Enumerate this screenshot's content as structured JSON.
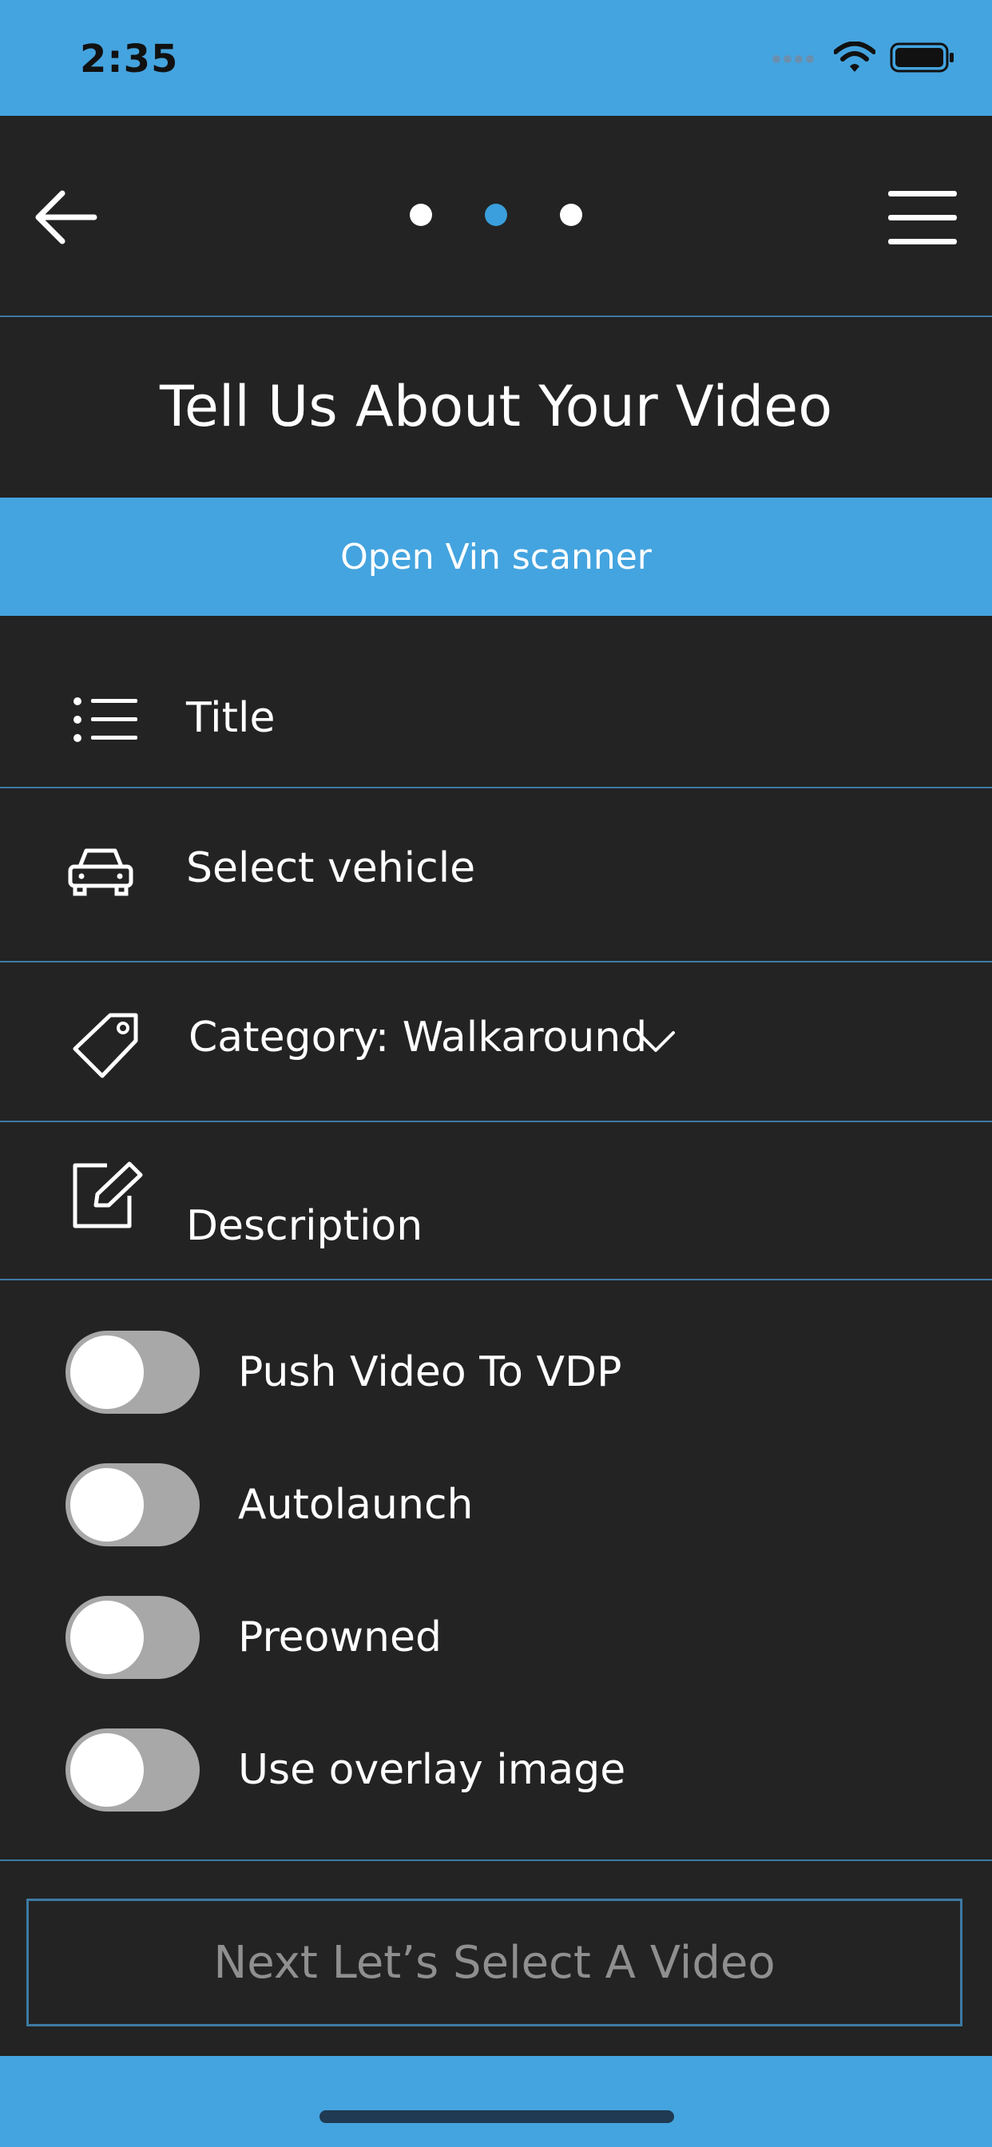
{
  "status_bar": {
    "time": "2:35",
    "icons": [
      "signal-icon",
      "wifi-icon",
      "battery-icon"
    ],
    "background": "#44a4df"
  },
  "nav": {
    "back_icon": "arrow-left-icon",
    "menu_icon": "hamburger-menu-icon",
    "steps_total": 3,
    "current_step": 2
  },
  "page_title": "Tell Us About Your Video",
  "vin_button": "Open Vin scanner",
  "fields": {
    "title": {
      "label": "Title",
      "icon": "list-icon"
    },
    "vehicle": {
      "label": "Select vehicle",
      "icon": "car-icon"
    },
    "category": {
      "label": "Category: Walkaround",
      "icon": "tag-icon",
      "dropdown_icon": "chevron-down-icon"
    },
    "description": {
      "label": "Description",
      "icon": "edit-icon"
    }
  },
  "toggles": [
    {
      "label": "Push Video To VDP",
      "on": false
    },
    {
      "label": "Autolaunch",
      "on": false
    },
    {
      "label": "Preowned",
      "on": false
    },
    {
      "label": "Use overlay image",
      "on": false
    }
  ],
  "next_button": "Next Let’s Select A Video",
  "colors": {
    "accent": "#44a4df",
    "background": "#232323",
    "divider": "#3d7aa3",
    "active_dot": "#3a9fdc"
  }
}
